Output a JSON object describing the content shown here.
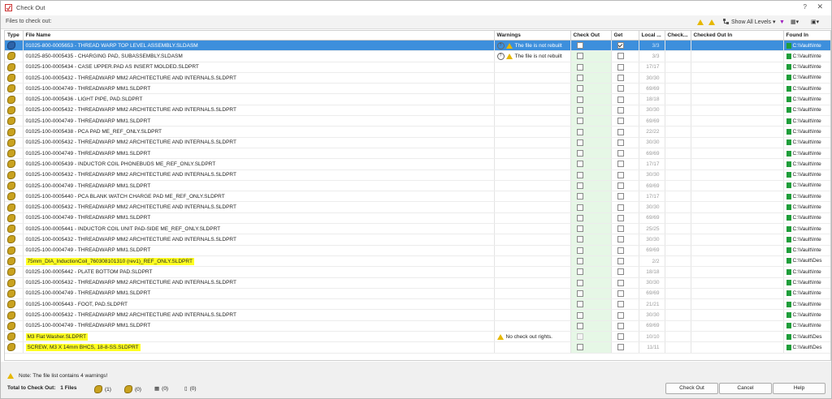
{
  "window": {
    "title": "Check Out",
    "help": "?",
    "close": "✕"
  },
  "toolbar": {
    "label": "Files to check out:",
    "show_levels": "Show All Levels"
  },
  "columns": [
    "Type",
    "File Name",
    "Warnings",
    "Check Out",
    "Get",
    "Local ...",
    "Check...",
    "Checked Out In",
    "Found In"
  ],
  "rows": [
    {
      "name": "01025-800-0005653 - THREAD WARP TOP LEVEL ASSEMBLY.SLDASM",
      "warning": "The file is not rebuilt",
      "q": true,
      "checkout": true,
      "get": true,
      "local": "3/3",
      "found": "C:\\Vault\\Inte",
      "selected": true
    },
    {
      "name": "01025-850-0005435 - CHARGING PAD, SUBASSEMBLY.SLDASM",
      "warning": "The file is not rebuilt",
      "q": true,
      "checkout": true,
      "get": true,
      "local": "3/3",
      "found": "C:\\Vault\\Inte"
    },
    {
      "name": "01025-100-0005434 - CASE UPPER.PAD AS INSERT MOLDED.SLDPRT",
      "warning": "",
      "checkout": true,
      "get": true,
      "local": "17/17",
      "found": "C:\\Vault\\Inte"
    },
    {
      "name": "01025-100-0005432 - THREADWARP MM2 ARCHITECTURE AND INTERNALS.SLDPRT",
      "warning": "",
      "checkout": true,
      "get": true,
      "local": "30/30",
      "found": "C:\\Vault\\Inte"
    },
    {
      "name": "01025-100-0004749 - THREADWARP MM1.SLDPRT",
      "warning": "",
      "checkout": true,
      "get": true,
      "local": "69/69",
      "found": "C:\\Vault\\Inte"
    },
    {
      "name": "01025-100-0005436 - LIGHT PIPE, PAD.SLDPRT",
      "warning": "",
      "checkout": true,
      "get": true,
      "local": "18/18",
      "found": "C:\\Vault\\Inte"
    },
    {
      "name": "01025-100-0005432 - THREADWARP MM2 ARCHITECTURE AND INTERNALS.SLDPRT",
      "warning": "",
      "checkout": true,
      "get": true,
      "local": "30/30",
      "found": "C:\\Vault\\Inte"
    },
    {
      "name": "01025-100-0004749 - THREADWARP MM1.SLDPRT",
      "warning": "",
      "checkout": true,
      "get": true,
      "local": "69/69",
      "found": "C:\\Vault\\Inte"
    },
    {
      "name": "01025-100-0005438 - PCA PAD ME_REF_ONLY.SLDPRT",
      "warning": "",
      "checkout": true,
      "get": true,
      "local": "22/22",
      "found": "C:\\Vault\\Inte"
    },
    {
      "name": "01025-100-0005432 - THREADWARP MM2 ARCHITECTURE AND INTERNALS.SLDPRT",
      "warning": "",
      "checkout": true,
      "get": true,
      "local": "30/30",
      "found": "C:\\Vault\\Inte"
    },
    {
      "name": "01025-100-0004749 - THREADWARP MM1.SLDPRT",
      "warning": "",
      "checkout": true,
      "get": true,
      "local": "69/69",
      "found": "C:\\Vault\\Inte"
    },
    {
      "name": "01025-100-0005439 - INDUCTOR COIL PHONEBUDS ME_REF_ONLY.SLDPRT",
      "warning": "",
      "checkout": true,
      "get": true,
      "local": "17/17",
      "found": "C:\\Vault\\Inte"
    },
    {
      "name": "01025-100-0005432 - THREADWARP MM2 ARCHITECTURE AND INTERNALS.SLDPRT",
      "warning": "",
      "checkout": true,
      "get": true,
      "local": "30/30",
      "found": "C:\\Vault\\Inte"
    },
    {
      "name": "01025-100-0004749 - THREADWARP MM1.SLDPRT",
      "warning": "",
      "checkout": true,
      "get": true,
      "local": "69/69",
      "found": "C:\\Vault\\Inte"
    },
    {
      "name": "01025-100-0005440 - PCA BLANK WATCH CHARGE PAD ME_REF_ONLY.SLDPRT",
      "warning": "",
      "checkout": true,
      "get": true,
      "local": "17/17",
      "found": "C:\\Vault\\Inte"
    },
    {
      "name": "01025-100-0005432 - THREADWARP MM2 ARCHITECTURE AND INTERNALS.SLDPRT",
      "warning": "",
      "checkout": true,
      "get": true,
      "local": "30/30",
      "found": "C:\\Vault\\Inte"
    },
    {
      "name": "01025-100-0004749 - THREADWARP MM1.SLDPRT",
      "warning": "",
      "checkout": true,
      "get": true,
      "local": "69/69",
      "found": "C:\\Vault\\Inte"
    },
    {
      "name": "01025-100-0005441 - INDUCTOR COIL UNIT PAD-SIDE ME_REF_ONLY.SLDPRT",
      "warning": "",
      "checkout": true,
      "get": true,
      "local": "25/25",
      "found": "C:\\Vault\\Inte"
    },
    {
      "name": "01025-100-0005432 - THREADWARP MM2 ARCHITECTURE AND INTERNALS.SLDPRT",
      "warning": "",
      "checkout": true,
      "get": true,
      "local": "30/30",
      "found": "C:\\Vault\\Inte"
    },
    {
      "name": "01025-100-0004749 - THREADWARP MM1.SLDPRT",
      "warning": "",
      "checkout": true,
      "get": true,
      "local": "69/69",
      "found": "C:\\Vault\\Inte"
    },
    {
      "name": "75mm_DIA_InductionCoil_760308101310 (rev1)_REF_ONLY.SLDPRT",
      "warning": "",
      "checkout": true,
      "get": true,
      "local": "2/2",
      "found": "C:\\Vault\\Des",
      "highlight": true
    },
    {
      "name": "01025-100-0005442 - PLATE BOTTOM PAD.SLDPRT",
      "warning": "",
      "checkout": true,
      "get": true,
      "local": "18/18",
      "found": "C:\\Vault\\Inte"
    },
    {
      "name": "01025-100-0005432 - THREADWARP MM2 ARCHITECTURE AND INTERNALS.SLDPRT",
      "warning": "",
      "checkout": true,
      "get": true,
      "local": "30/30",
      "found": "C:\\Vault\\Inte"
    },
    {
      "name": "01025-100-0004749 - THREADWARP MM1.SLDPRT",
      "warning": "",
      "checkout": true,
      "get": true,
      "local": "69/69",
      "found": "C:\\Vault\\Inte"
    },
    {
      "name": "01025-100-0005443 - FOOT, PAD.SLDPRT",
      "warning": "",
      "checkout": true,
      "get": true,
      "local": "21/21",
      "found": "C:\\Vault\\Inte"
    },
    {
      "name": "01025-100-0005432 - THREADWARP MM2 ARCHITECTURE AND INTERNALS.SLDPRT",
      "warning": "",
      "checkout": true,
      "get": true,
      "local": "30/30",
      "found": "C:\\Vault\\Inte"
    },
    {
      "name": "01025-100-0004749 - THREADWARP MM1.SLDPRT",
      "warning": "",
      "checkout": true,
      "get": true,
      "local": "69/69",
      "found": "C:\\Vault\\Inte"
    },
    {
      "name": "M3 Flat Washer.SLDPRT",
      "warning": "No check out rights.",
      "checkout": true,
      "get": true,
      "local": "10/10",
      "found": "C:\\Vault\\Des",
      "highlight": true,
      "dis": true
    },
    {
      "name": "SCREW, M3 X 14mm BHCS, 18-8-SS.SLDPRT",
      "warning": "",
      "checkout": true,
      "get": true,
      "local": "11/11",
      "found": "C:\\Vault\\Des",
      "highlight": true
    }
  ],
  "footer": {
    "note": "Note: The file list contains 4 warnings!",
    "total_label": "Total to Check Out:",
    "total_value": "1 Files",
    "stats": [
      "(1)",
      "(0)",
      "(0)",
      "(0)"
    ],
    "buttons": {
      "checkout": "Check Out",
      "cancel": "Cancel",
      "help": "Help"
    }
  }
}
